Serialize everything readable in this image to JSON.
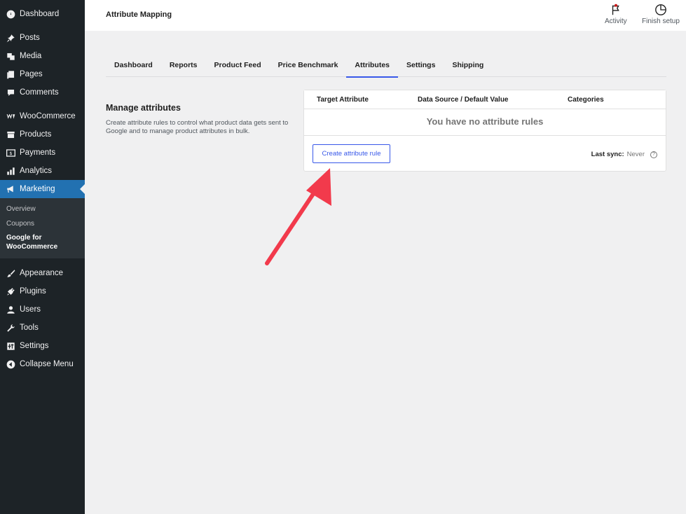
{
  "sidebar": {
    "items": [
      {
        "label": "Dashboard",
        "icon": "dashboard-icon"
      },
      {
        "label": "Posts",
        "icon": "pin-icon"
      },
      {
        "label": "Media",
        "icon": "media-icon"
      },
      {
        "label": "Pages",
        "icon": "pages-icon"
      },
      {
        "label": "Comments",
        "icon": "comment-icon"
      },
      {
        "label": "WooCommerce",
        "icon": "woo-icon"
      },
      {
        "label": "Products",
        "icon": "archive-icon"
      },
      {
        "label": "Payments",
        "icon": "dollar-icon"
      },
      {
        "label": "Analytics",
        "icon": "bar-chart-icon"
      },
      {
        "label": "Marketing",
        "icon": "megaphone-icon"
      },
      {
        "label": "Appearance",
        "icon": "brush-icon"
      },
      {
        "label": "Plugins",
        "icon": "plug-icon"
      },
      {
        "label": "Users",
        "icon": "user-icon"
      },
      {
        "label": "Tools",
        "icon": "wrench-icon"
      },
      {
        "label": "Settings",
        "icon": "sliders-icon"
      },
      {
        "label": "Collapse Menu",
        "icon": "collapse-icon"
      }
    ],
    "submenu": {
      "overview": "Overview",
      "coupons": "Coupons",
      "google": "Google for WooCommerce"
    }
  },
  "header": {
    "title": "Attribute Mapping",
    "activity": "Activity",
    "finish_setup": "Finish setup"
  },
  "tabs": [
    "Dashboard",
    "Reports",
    "Product Feed",
    "Price Benchmark",
    "Attributes",
    "Settings",
    "Shipping"
  ],
  "active_tab": "Attributes",
  "section": {
    "title": "Manage attributes",
    "description": "Create attribute rules to control what product data gets sent to Google and to manage product attributes in bulk."
  },
  "table": {
    "headers": [
      "Target Attribute",
      "Data Source / Default Value",
      "Categories"
    ],
    "empty_message": "You have no attribute rules",
    "create_button": "Create attribute rule",
    "last_sync_label": "Last sync:",
    "last_sync_value": "Never"
  },
  "colors": {
    "sidebar_bg": "#1d2327",
    "accent": "#2271b1",
    "primary": "#3858e9",
    "arrow": "#f23a4c"
  }
}
